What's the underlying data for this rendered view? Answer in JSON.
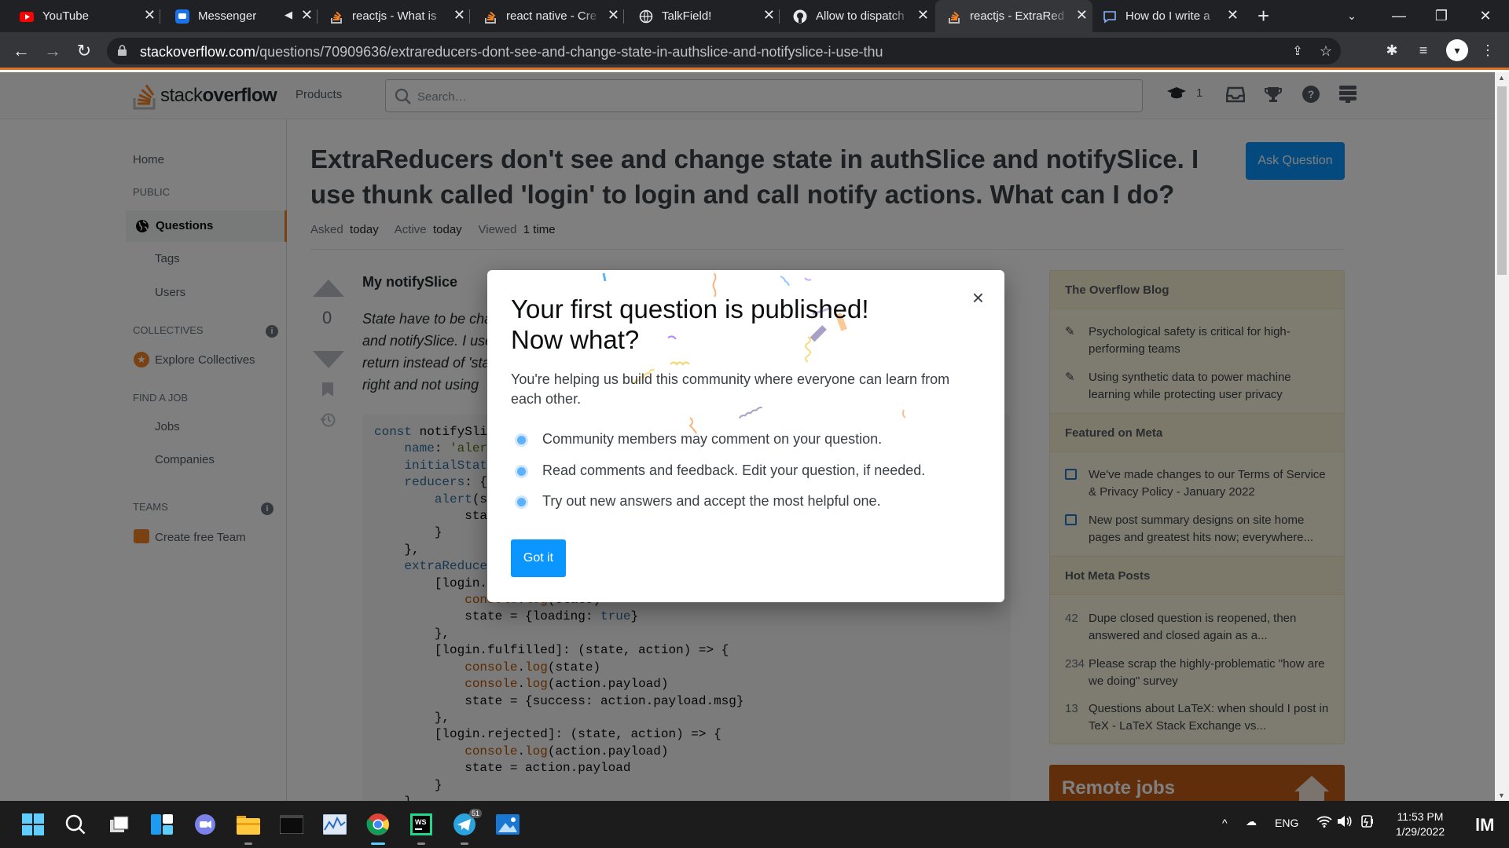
{
  "browser": {
    "tabs": [
      {
        "title": "YouTube",
        "icon": "youtube-icon"
      },
      {
        "title": "Messenger",
        "icon": "messenger-icon",
        "muted": true
      },
      {
        "title": "reactjs - What is",
        "icon": "stackoverflow-icon"
      },
      {
        "title": "react native - Cre",
        "icon": "stackoverflow-icon"
      },
      {
        "title": "TalkField!",
        "icon": "globe-icon"
      },
      {
        "title": "Allow to dispatch",
        "icon": "github-icon"
      },
      {
        "title": "reactjs - ExtraRed",
        "icon": "stackoverflow-icon",
        "active": true
      },
      {
        "title": "How do I write a",
        "icon": "chat-icon"
      }
    ],
    "url_domain": "stackoverflow.com",
    "url_path": "/questions/70909636/extrareducers-dont-see-and-change-state-in-authslice-and-notifyslice-i-use-thu",
    "accent": "#e07026"
  },
  "so": {
    "logo_light": "stack",
    "logo_bold": "overflow",
    "products": "Products",
    "search_placeholder": "Search…",
    "inbox_count": "1",
    "brand_orange": "#f48225",
    "primary_blue": "#0a95ff"
  },
  "leftnav": {
    "home": "Home",
    "public": "PUBLIC",
    "questions": "Questions",
    "tags": "Tags",
    "users": "Users",
    "collectives": "COLLECTIVES",
    "explore": "Explore Collectives",
    "find_job": "FIND A JOB",
    "jobs": "Jobs",
    "companies": "Companies",
    "teams": "TEAMS",
    "create_team": "Create free Team"
  },
  "question": {
    "title": "ExtraReducers don't see and change state in authSlice and notifySlice. I use thunk called 'login' to login and call notify actions. What can I do?",
    "ask_button": "Ask Question",
    "asked_label": "Asked",
    "asked_value": "today",
    "active_label": "Active",
    "active_value": "today",
    "viewed_label": "Viewed",
    "viewed_value": "1 time",
    "votes": "0",
    "heading": "My notifySlice",
    "body_lines": [
      "State have to be cha",
      "and notifySlice. I use",
      "return instead of 'sta",
      "right and not using"
    ]
  },
  "code_lines": [
    "const notifySli",
    "    name: 'aler",
    "    initialStat",
    "    reducers: {",
    "        alert(st",
    "            sta",
    "        }",
    "    },",
    "    extraReduce",
    "        [login.",
    "            console.log(state)",
    "            state = {loading: true}",
    "        },",
    "        [login.fulfilled]: (state, action) => {",
    "            console.log(state)",
    "            console.log(action.payload)",
    "            state = {success: action.payload.msg}",
    "        },",
    "        [login.rejected]: (state, action) => {",
    "            console.log(action.payload)",
    "            state = action.payload",
    "        }",
    "    }"
  ],
  "sidebar": {
    "blog_title": "The Overflow Blog",
    "blog_items": [
      "Psychological safety is critical for high-performing teams",
      "Using synthetic data to power machine learning while protecting user privacy"
    ],
    "meta_title": "Featured on Meta",
    "meta_items": [
      "We've made changes to our Terms of Service & Privacy Policy - January 2022",
      "New post summary designs on site home pages and greatest hits now; everywhere..."
    ],
    "hot_title": "Hot Meta Posts",
    "hot_items": [
      {
        "count": "42",
        "text": "Dupe closed question is reopened, then answered and closed again as a..."
      },
      {
        "count": "234",
        "text": "Please scrap the highly-problematic \"how are we doing\" survey"
      },
      {
        "count": "13",
        "text": "Questions about LaTeX: when should I post in TeX - LaTeX Stack Exchange vs..."
      }
    ],
    "remote_jobs": "Remote jobs"
  },
  "modal": {
    "title_line1": "Your first question is published!",
    "title_line2": "Now what?",
    "lead": "You're helping us build this community where everyone can learn from each other.",
    "bullets": [
      "Community members may comment on your question.",
      "Read comments and feedback. Edit your question, if needed.",
      "Try out new answers and accept the most helpful one."
    ],
    "button": "Got it",
    "close": "×"
  },
  "taskbar": {
    "language": "ENG",
    "time": "11:53 PM",
    "date": "1/29/2022",
    "telegram_badge": "51"
  }
}
